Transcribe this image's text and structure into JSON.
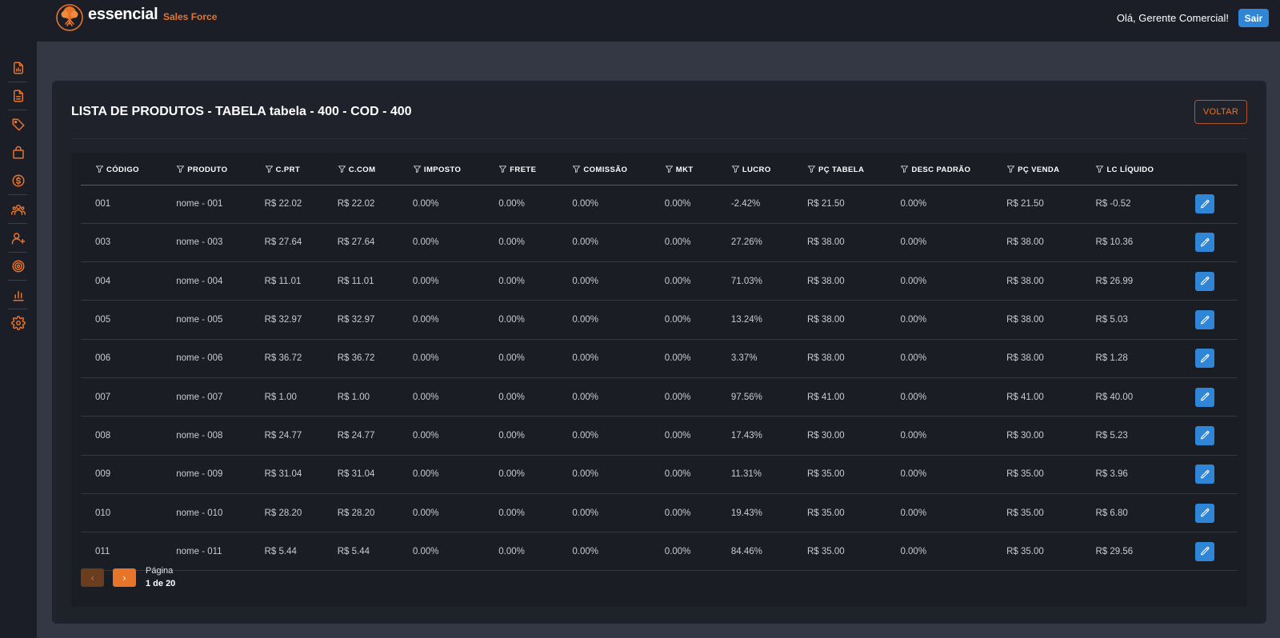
{
  "brand": {
    "name": "essencial",
    "sub": "Sales Force"
  },
  "header": {
    "greeting": "Olá, Gerente Comercial!",
    "logout_label": "Sair"
  },
  "sidebar": {
    "icons": [
      "report-icon",
      "document-icon",
      "tag-icon",
      "shopping-bag-icon",
      "dollar-icon",
      "users-icon",
      "user-plus-icon",
      "target-icon",
      "bar-chart-icon",
      "gear-icon"
    ]
  },
  "page": {
    "title": "LISTA DE PRODUTOS - TABELA tabela - 400 - COD - 400",
    "back_label": "VOLTAR"
  },
  "table": {
    "columns": [
      "CÓDIGO",
      "PRODUTO",
      "C.PRT",
      "C.COM",
      "IMPOSTO",
      "FRETE",
      "COMISSÃO",
      "MKT",
      "LUCRO",
      "PÇ TABELA",
      "DESC PADRÃO",
      "PÇ VENDA",
      "LC LÍQUIDO"
    ],
    "rows": [
      [
        "001",
        "nome - 001",
        "R$ 22.02",
        "R$ 22.02",
        "0.00%",
        "0.00%",
        "0.00%",
        "0.00%",
        "-2.42%",
        "R$ 21.50",
        "0.00%",
        "R$ 21.50",
        "R$ -0.52"
      ],
      [
        "003",
        "nome - 003",
        "R$ 27.64",
        "R$ 27.64",
        "0.00%",
        "0.00%",
        "0.00%",
        "0.00%",
        "27.26%",
        "R$ 38.00",
        "0.00%",
        "R$ 38.00",
        "R$ 10.36"
      ],
      [
        "004",
        "nome - 004",
        "R$ 11.01",
        "R$ 11.01",
        "0.00%",
        "0.00%",
        "0.00%",
        "0.00%",
        "71.03%",
        "R$ 38.00",
        "0.00%",
        "R$ 38.00",
        "R$ 26.99"
      ],
      [
        "005",
        "nome - 005",
        "R$ 32.97",
        "R$ 32.97",
        "0.00%",
        "0.00%",
        "0.00%",
        "0.00%",
        "13.24%",
        "R$ 38.00",
        "0.00%",
        "R$ 38.00",
        "R$ 5.03"
      ],
      [
        "006",
        "nome - 006",
        "R$ 36.72",
        "R$ 36.72",
        "0.00%",
        "0.00%",
        "0.00%",
        "0.00%",
        "3.37%",
        "R$ 38.00",
        "0.00%",
        "R$ 38.00",
        "R$ 1.28"
      ],
      [
        "007",
        "nome - 007",
        "R$ 1.00",
        "R$ 1.00",
        "0.00%",
        "0.00%",
        "0.00%",
        "0.00%",
        "97.56%",
        "R$ 41.00",
        "0.00%",
        "R$ 41.00",
        "R$ 40.00"
      ],
      [
        "008",
        "nome - 008",
        "R$ 24.77",
        "R$ 24.77",
        "0.00%",
        "0.00%",
        "0.00%",
        "0.00%",
        "17.43%",
        "R$ 30.00",
        "0.00%",
        "R$ 30.00",
        "R$ 5.23"
      ],
      [
        "009",
        "nome - 009",
        "R$ 31.04",
        "R$ 31.04",
        "0.00%",
        "0.00%",
        "0.00%",
        "0.00%",
        "11.31%",
        "R$ 35.00",
        "0.00%",
        "R$ 35.00",
        "R$ 3.96"
      ],
      [
        "010",
        "nome - 010",
        "R$ 28.20",
        "R$ 28.20",
        "0.00%",
        "0.00%",
        "0.00%",
        "0.00%",
        "19.43%",
        "R$ 35.00",
        "0.00%",
        "R$ 35.00",
        "R$ 6.80"
      ],
      [
        "011",
        "nome - 011",
        "R$ 5.44",
        "R$ 5.44",
        "0.00%",
        "0.00%",
        "0.00%",
        "0.00%",
        "84.46%",
        "R$ 35.00",
        "0.00%",
        "R$ 35.00",
        "R$ 29.56"
      ]
    ]
  },
  "pagination": {
    "prev_symbol": "‹",
    "next_symbol": "›",
    "label": "Página",
    "count": "1 de 20"
  },
  "colors": {
    "accent": "#e8742a",
    "primary": "#2f86d6",
    "background": "#343744",
    "surface": "#1f212b"
  }
}
